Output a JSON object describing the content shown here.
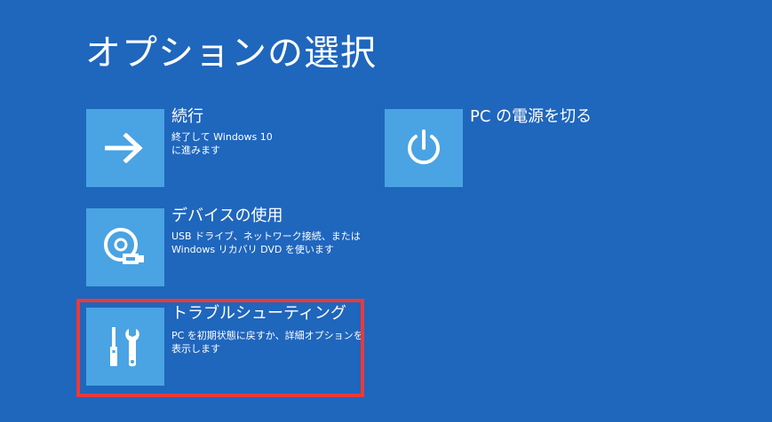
{
  "page": {
    "title": "オプションの選択"
  },
  "options": {
    "continue": {
      "icon": "arrow-right-icon",
      "title": "続行",
      "desc_line1": "終了して Windows 10",
      "desc_line2": "に進みます"
    },
    "device": {
      "icon": "disc-usb-icon",
      "title": "デバイスの使用",
      "desc_line1": "USB ドライブ、ネットワーク接続、または",
      "desc_line2": "Windows リカバリ DVD を使います"
    },
    "troubleshoot": {
      "icon": "tools-icon",
      "title": "トラブルシューティング",
      "desc_line1": "PC を初期状態に戻すか、詳細オプションを",
      "desc_line2": "表示します"
    },
    "power": {
      "icon": "power-icon",
      "title": "PC の電源を切る"
    }
  },
  "colors": {
    "background": "#1f66bd",
    "tile": "#4aa3e3",
    "highlight": "#e83a3a",
    "text": "#ffffff"
  }
}
